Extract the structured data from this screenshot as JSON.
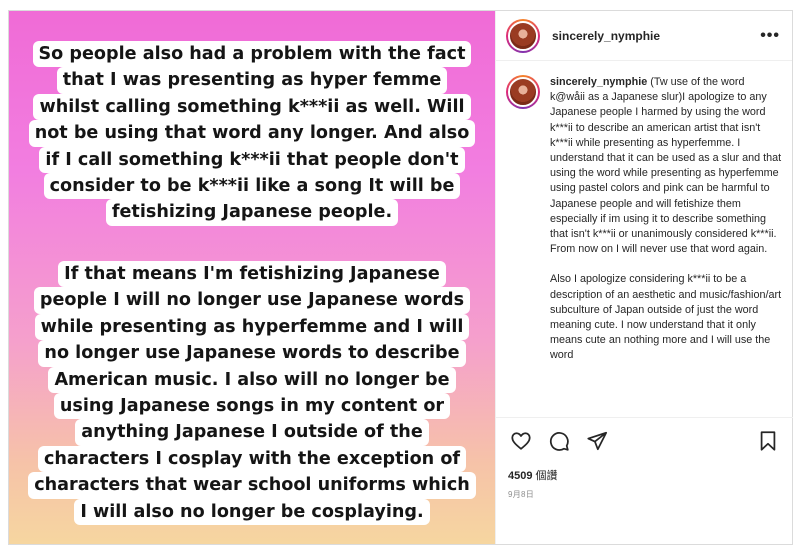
{
  "post": {
    "story_paragraph_1": [
      "So people also had a problem with the fact",
      "that I was presenting as hyper femme",
      "whilst calling something k***ii as well. Will",
      "not be using that word any longer. And also",
      "if I call something k***ii that people don't",
      "consider to be k***ii like a song It will be",
      "fetishizing Japanese people."
    ],
    "story_paragraph_2": [
      "If that means I'm fetishizing Japanese",
      "people I will no longer use Japanese words",
      "while presenting as hyperfemme and I will",
      "no longer use Japanese words to describe",
      "American music. I also will no longer be",
      "using Japanese songs in my content or",
      "anything Japanese I outside of the",
      "characters I cosplay with the exception of",
      "characters that wear school uniforms which",
      "I will also no longer be cosplaying."
    ]
  },
  "header": {
    "username": "sincerely_nymphie",
    "more_label": "•••"
  },
  "caption": {
    "username": "sincerely_nymphie",
    "paragraph_1": "(Tw use of the word k@wåii as a Japanese slur)I apologize to any Japanese people I harmed by using the word k***ii to describe an american artist that isn't k***ii while presenting as hyperfemme. I understand that it can be used as a slur and that using the word while presenting as hyperfemme using pastel colors and pink can be harmful to Japanese people and will fetishize them especially if im using it to describe something that isn't k***ii or unanimously considered k***ii. From now on I will never use that word again.",
    "paragraph_2": "Also I apologize considering k***ii to be a description of an aesthetic and music/fashion/art subculture of Japan outside of just the word meaning cute. I now understand that it only means cute an nothing more and I will use the word"
  },
  "actions": {
    "like_icon": "heart-icon",
    "comment_icon": "comment-icon",
    "share_icon": "paper-plane-icon",
    "save_icon": "bookmark-icon"
  },
  "stats": {
    "likes_count": "4509",
    "likes_label": "個讚",
    "date": "9月8日"
  },
  "colors": {
    "gradient_top": "#f06bd6",
    "gradient_bottom": "#f6d6a0",
    "text": "#262626",
    "muted": "#8e8e8e"
  }
}
